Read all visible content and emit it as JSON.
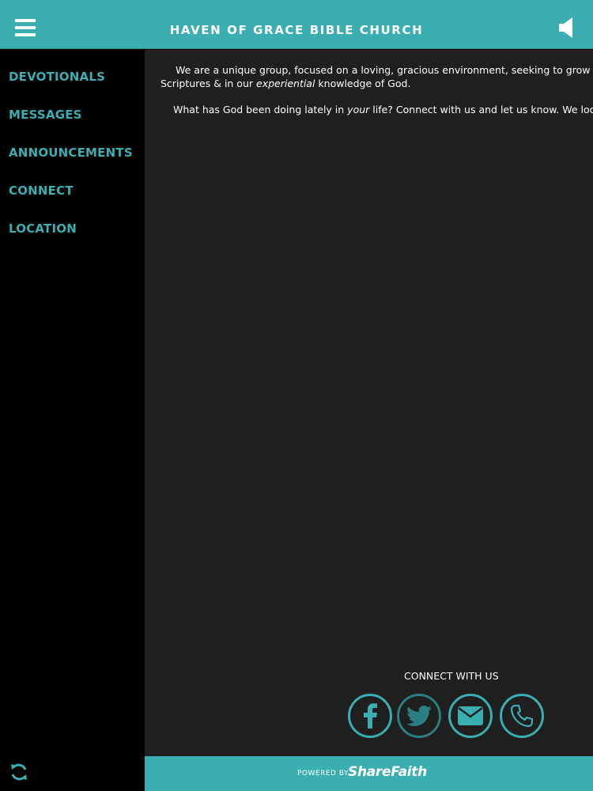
{
  "header": {
    "title": "HAVEN OF GRACE BIBLE CHURCH",
    "menu_icon": "hamburger-menu-icon",
    "audio_icon": "speaker-icon"
  },
  "sidebar": {
    "items": [
      {
        "label": "DEVOTIONALS"
      },
      {
        "label": "MESSAGES"
      },
      {
        "label": "ANNOUNCEMENTS"
      },
      {
        "label": "CONNECT"
      },
      {
        "label": "LOCATION"
      }
    ],
    "refresh_icon": "refresh-icon"
  },
  "content": {
    "p1_line1": "We are a unique group, focused on a loving, gracious environment, seeking to grow together in the",
    "p1_line2_before": "Scriptures & in our ",
    "p1_line2_em": "experiential",
    "p1_line2_after": " knowledge of God.",
    "p2_before": "What has God been doing lately in ",
    "p2_em": "your",
    "p2_after": " life?  Connect with us and let us know.  We look forward to hearing from you!"
  },
  "connect": {
    "label": "CONNECT WITH US",
    "buttons": [
      {
        "icon": "facebook-icon"
      },
      {
        "icon": "twitter-icon"
      },
      {
        "icon": "email-icon"
      },
      {
        "icon": "phone-icon"
      }
    ]
  },
  "footer": {
    "powered_by": "POWERED BY",
    "brand": "ShareFaith"
  },
  "colors": {
    "accent": "#3aaeb0",
    "sidebar_bg": "#000000",
    "content_bg": "#1f1f1f"
  }
}
